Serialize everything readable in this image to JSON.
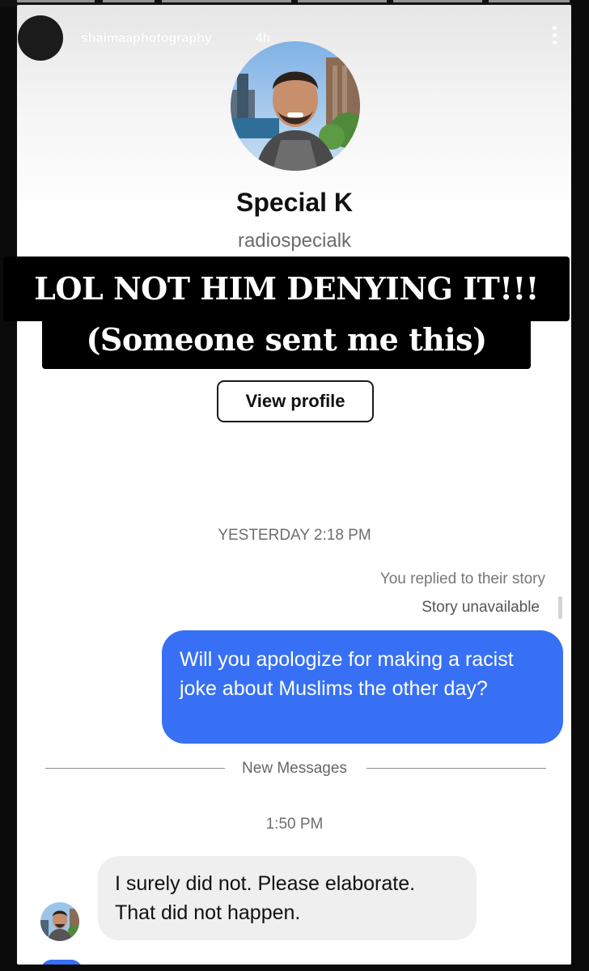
{
  "story_header": {
    "username": "shaimaaphotography",
    "time_ago": "4h",
    "avatar_icon": "user-avatar-icon",
    "menu_icon": "more-vertical-icon"
  },
  "profile": {
    "photo": "profile-photo",
    "name": "Special K",
    "handle": "radiospecialk",
    "view_profile_label": "View profile"
  },
  "overlay": {
    "line1": "LOL NOT HIM DENYING IT!!!",
    "line2": "(Someone sent me this)"
  },
  "conversation": {
    "timestamp_1": "YESTERDAY 2:18 PM",
    "replied_note": "You replied to their story",
    "story_unavailable": "Story unavailable",
    "outgoing_message": "Will you apologize for making a racist joke about Muslims the other day?",
    "new_messages_label": "New Messages",
    "timestamp_2": "1:50 PM",
    "incoming_message": "I surely did not. Please elaborate. That did not happen."
  },
  "colors": {
    "outgoing_bubble": "#3770f5",
    "incoming_bubble": "#efefef",
    "caption_bg": "#000000"
  }
}
